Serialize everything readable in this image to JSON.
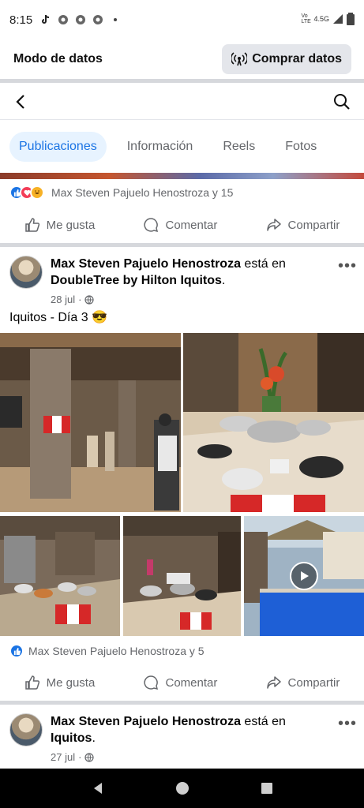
{
  "status_bar": {
    "time": "8:15",
    "network": "4.5G",
    "carrier": "Vo LTE"
  },
  "data_mode": {
    "label": "Modo de datos",
    "buy_button": "Comprar datos"
  },
  "tabs": [
    {
      "label": "Publicaciones",
      "active": true
    },
    {
      "label": "Información",
      "active": false
    },
    {
      "label": "Reels",
      "active": false
    },
    {
      "label": "Fotos",
      "active": false
    }
  ],
  "previous_post": {
    "reactions_text": "Max Steven Pajuelo Henostroza y 15"
  },
  "actions": {
    "like": "Me gusta",
    "comment": "Comentar",
    "share": "Compartir"
  },
  "post1": {
    "author": "Max Steven Pajuelo Henostroza",
    "location_connector": "está en",
    "location": "DoubleTree by Hilton Iquitos",
    "date": "28 jul",
    "caption": "Iquitos - Día 3 😎",
    "reactions_text": "Max Steven Pajuelo Henostroza y 5"
  },
  "post2": {
    "author": "Max Steven Pajuelo Henostroza",
    "location_connector": "está en",
    "location": "Iquitos",
    "date": "27 jul"
  },
  "colors": {
    "accent": "#1b74e4",
    "tab_active_bg": "#e7f3ff",
    "secondary_text": "#65676b"
  }
}
